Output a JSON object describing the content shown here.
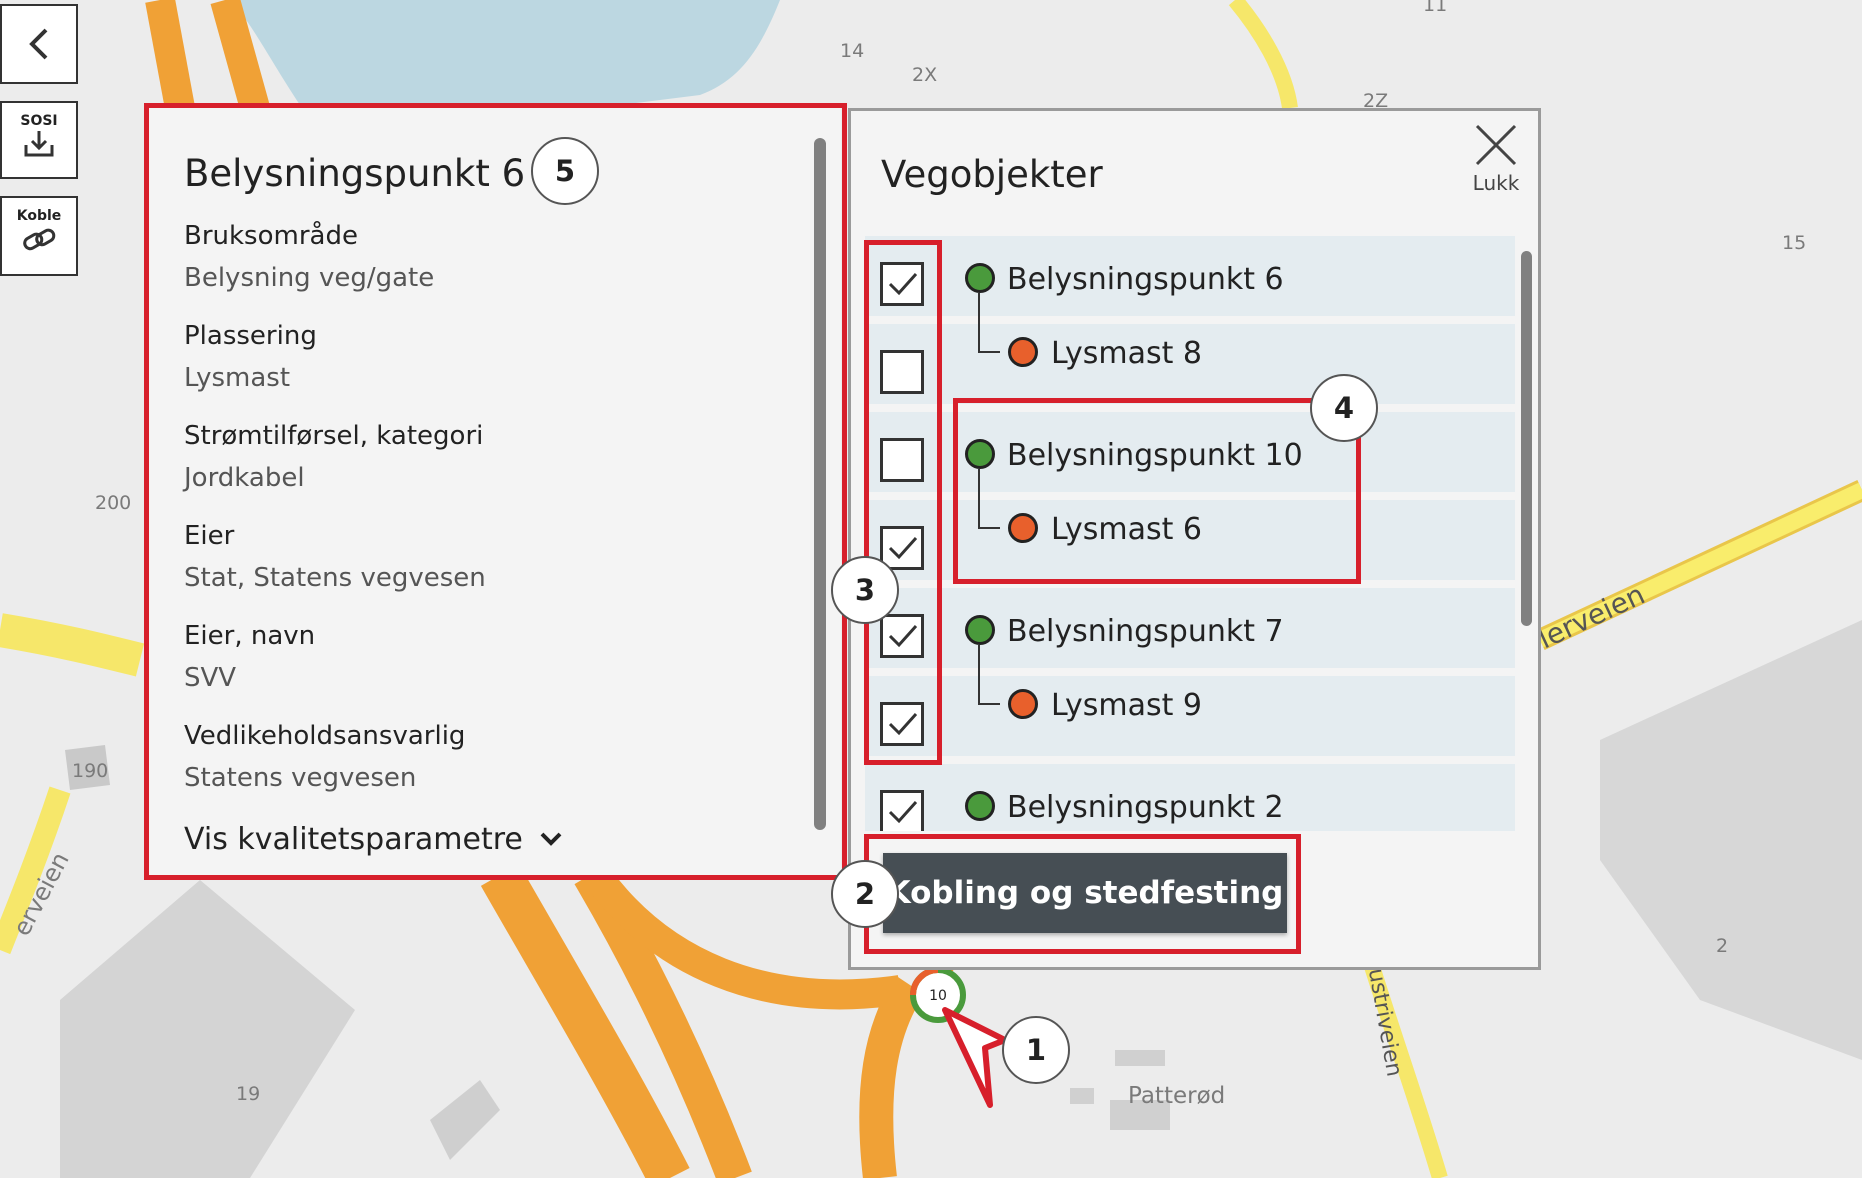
{
  "toolbar": {
    "sosi_label": "SOSI",
    "koble_label": "Koble"
  },
  "map": {
    "labels": [
      "14",
      "2X",
      "2Z",
      "11",
      "15",
      "200",
      "190",
      "19",
      "2",
      "Patterød",
      "erveien",
      "lerveien",
      "ustriveien"
    ],
    "cluster_count": "10"
  },
  "detail": {
    "title": "Belysningspunkt 6",
    "fields": [
      {
        "label": "Bruksområde",
        "value": "Belysning veg/gate"
      },
      {
        "label": "Plassering",
        "value": "Lysmast"
      },
      {
        "label": "Strømtilførsel, kategori",
        "value": "Jordkabel"
      },
      {
        "label": "Eier",
        "value": "Stat, Statens vegvesen"
      },
      {
        "label": "Eier, navn",
        "value": "SVV"
      },
      {
        "label": "Vedlikeholdsansvarlig",
        "value": "Statens vegvesen"
      }
    ],
    "quality_toggle": "Vis kvalitetsparametre"
  },
  "vegobjekter": {
    "title": "Vegobjekter",
    "close_label": "Lukk",
    "items": [
      {
        "label": "Belysningspunkt 6",
        "type": "parent",
        "checked": true,
        "dot": "#4a9a3c"
      },
      {
        "label": "Lysmast 8",
        "type": "child",
        "checked": false,
        "dot": "#e8602c"
      },
      {
        "label": "Belysningspunkt 10",
        "type": "parent",
        "checked": false,
        "dot": "#4a9a3c"
      },
      {
        "label": "Lysmast 6",
        "type": "child",
        "checked": true,
        "dot": "#e8602c"
      },
      {
        "label": "Belysningspunkt 7",
        "type": "parent",
        "checked": true,
        "dot": "#4a9a3c"
      },
      {
        "label": "Lysmast 9",
        "type": "child",
        "checked": true,
        "dot": "#e8602c"
      },
      {
        "label": "Belysningspunkt 2",
        "type": "parent",
        "checked": true,
        "dot": "#4a9a3c"
      }
    ],
    "action_button": "Kobling og stedfesting"
  },
  "annotations": [
    "1",
    "2",
    "3",
    "4",
    "5"
  ],
  "colors": {
    "highlight": "#d71f2b",
    "road": "#f4a83a",
    "water": "#b9d6e0",
    "button_dark": "#464e54"
  }
}
